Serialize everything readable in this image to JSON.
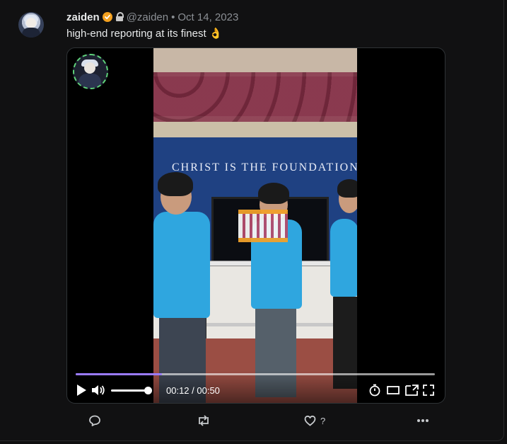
{
  "post": {
    "author_name": "zaiden",
    "handle": "@zaiden",
    "separator": "•",
    "date": "Oct 14, 2023",
    "text": "high-end reporting at its finest 👌"
  },
  "video": {
    "banner_text": "CHRIST IS THE FOUNDATION",
    "time": "00:12 / 00:50",
    "progress_fraction": 0.24,
    "volume_fraction": 0.9
  },
  "actions": {
    "like_count": "?"
  },
  "colors": {
    "progress_fill": "#9a7bff",
    "verified_badge": "#f4a11f"
  },
  "icons": [
    "avatar",
    "verified-badge-icon",
    "lock-icon",
    "play-icon",
    "volume-icon",
    "timer-icon",
    "theater-mode-icon",
    "pip-icon",
    "fullscreen-icon",
    "reply-icon",
    "retweet-icon",
    "heart-icon",
    "more-icon"
  ]
}
